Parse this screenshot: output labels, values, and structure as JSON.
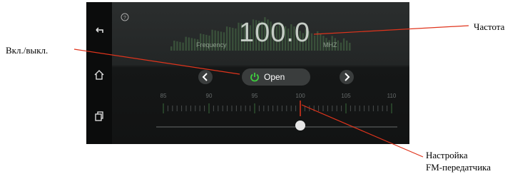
{
  "radio": {
    "frequency": "100.0",
    "frequency_label": "Frequency",
    "unit": "MHZ",
    "power_button": "Open",
    "scale": [
      "85",
      "90",
      "95",
      "100",
      "105",
      "110"
    ],
    "slider_value": 100.0
  },
  "sidebar": {
    "icons": [
      "back-icon",
      "home-icon",
      "recent-apps-icon"
    ]
  },
  "annotations": {
    "frequency": "Частота",
    "power": "Вкл./выкл.",
    "tuning_line1": "Настройка",
    "tuning_line2": "FM-передатчика"
  },
  "colors": {
    "accent_green": "#3ecf3e",
    "callout_line": "#e0341c",
    "screen_bg": "#17191a"
  }
}
